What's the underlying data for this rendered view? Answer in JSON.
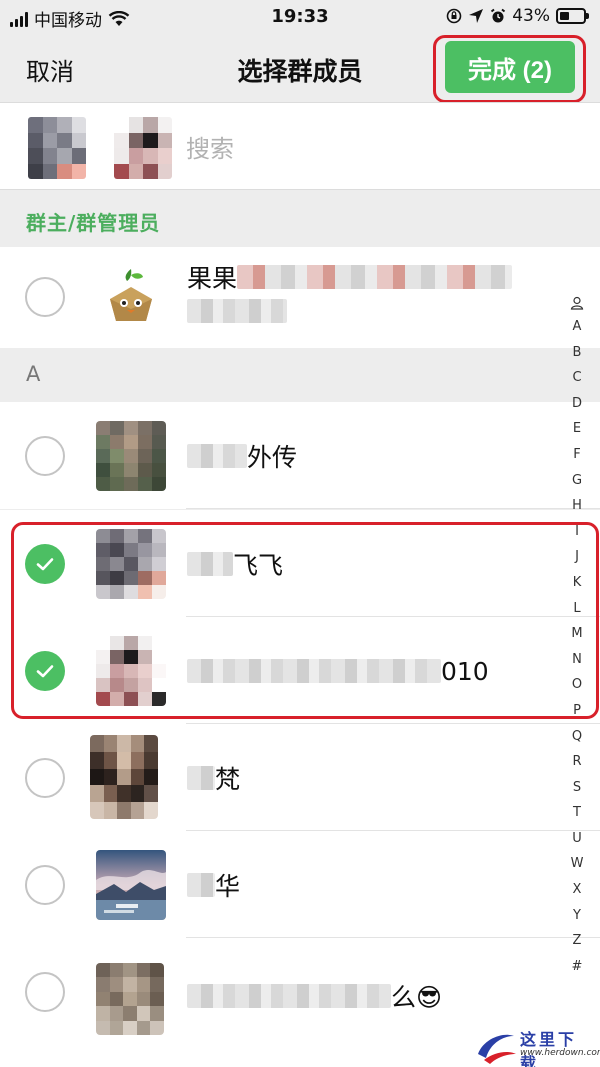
{
  "status_bar": {
    "carrier": "中国移动",
    "time": "19:33",
    "battery": "43%",
    "battery_level": 0.43
  },
  "nav": {
    "cancel_label": "取消",
    "title": "选择群成员",
    "done_label": "完成 (2)"
  },
  "search": {
    "placeholder": "搜索",
    "value": ""
  },
  "sections": {
    "admin_header": "群主/群管理员",
    "a_header": "A"
  },
  "members": [
    {
      "name_prefix": "果果",
      "name_suffix": "",
      "selected": false
    },
    {
      "name_prefix": "",
      "name_suffix": "外传",
      "selected": false
    },
    {
      "name_prefix": "",
      "name_suffix": "飞飞",
      "selected": true
    },
    {
      "name_prefix": "",
      "name_suffix": "010",
      "selected": true
    },
    {
      "name_prefix": "",
      "name_suffix": "梵",
      "selected": false
    },
    {
      "name_prefix": "",
      "name_suffix": "华",
      "selected": false
    },
    {
      "name_prefix": "",
      "name_suffix": "么😎",
      "selected": false
    }
  ],
  "index_letters": [
    "A",
    "B",
    "C",
    "D",
    "E",
    "F",
    "G",
    "H",
    "I",
    "J",
    "K",
    "L",
    "M",
    "N",
    "O",
    "P",
    "Q",
    "R",
    "S",
    "T",
    "U",
    "W",
    "X",
    "Y",
    "Z",
    "#"
  ],
  "watermark": {
    "title": "这里下载",
    "url": "www.herdown.com"
  },
  "colors": {
    "accent_green": "#4cbf63",
    "section_green": "#4cae5e",
    "highlight_red": "#d8202a"
  }
}
